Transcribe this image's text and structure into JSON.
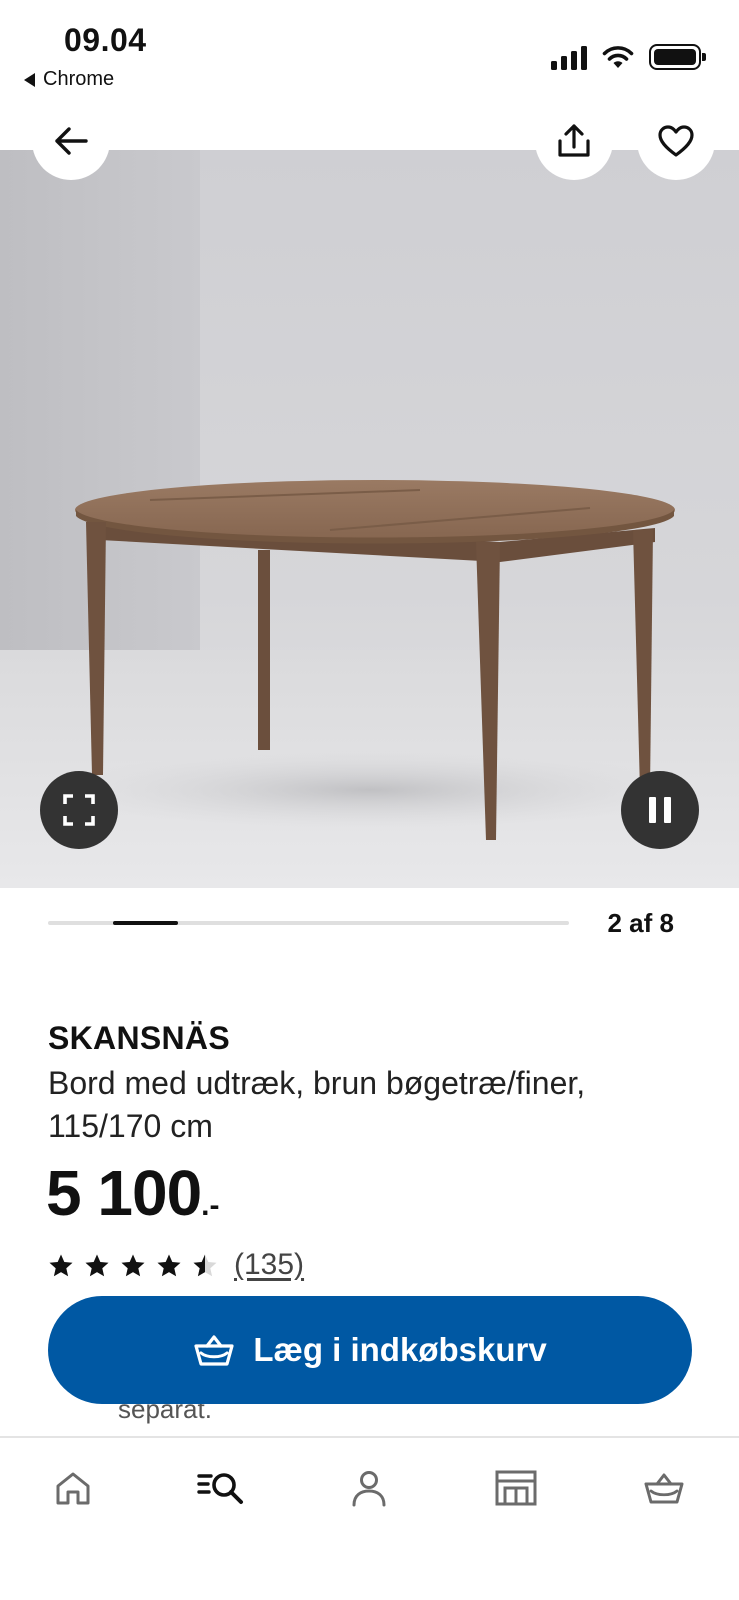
{
  "status_bar": {
    "time": "09.04",
    "back_app": "Chrome"
  },
  "gallery": {
    "current": 2,
    "total": 8,
    "counter_text": "2 af 8",
    "back_icon": "arrow-left-icon",
    "share_icon": "share-icon",
    "favorite_icon": "heart-icon",
    "fullscreen_icon": "fullscreen-icon",
    "pause_icon": "pause-icon"
  },
  "product": {
    "name": "SKANSNÄS",
    "description": "Bord med udtræk, brun bøgetræ/finer, 115/170 cm",
    "price": "5 100",
    "price_suffix": ".-",
    "rating": 4.5,
    "rating_max": 5,
    "review_count": "(135)"
  },
  "cart_button": {
    "label": "Læg i indkøbskurv",
    "color": "#0058a3"
  },
  "behind_text": "separat.",
  "bottom_nav": {
    "items": [
      {
        "name": "home",
        "icon": "home-icon"
      },
      {
        "name": "search",
        "icon": "search-icon"
      },
      {
        "name": "profile",
        "icon": "profile-icon"
      },
      {
        "name": "store",
        "icon": "store-icon"
      },
      {
        "name": "cart",
        "icon": "basket-icon"
      }
    ]
  }
}
